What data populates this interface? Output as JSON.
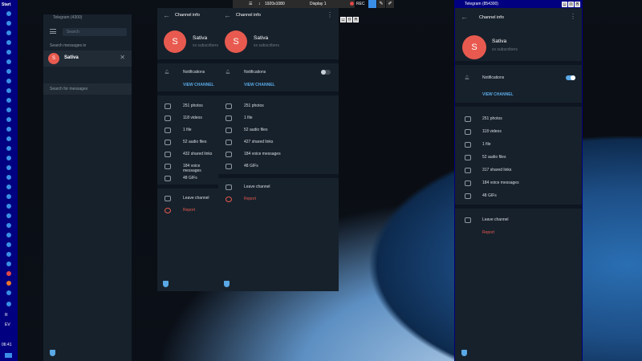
{
  "taskbar": {
    "start_label": "Start",
    "clock": "06:41",
    "misc1": "EV",
    "misc2": "R"
  },
  "display_toolbar": {
    "resolution": "1920x1080",
    "display": "Display 1",
    "rec": "REC"
  },
  "chat_list": {
    "title": "Telegram (4300)",
    "search_placeholder": "Search",
    "search_messages_in": "Search messages in",
    "chat_avatar": "S",
    "chat_name": "Sativa",
    "search_for_messages": "Search for messages"
  },
  "panel_left": {
    "header": "Channel info",
    "avatar": "S",
    "name": "Sativa",
    "subs": "xx subscribers",
    "notifications": "Notifications",
    "view_channel": "VIEW CHANNEL",
    "media": [
      "251 photos",
      "118 videos",
      "1 file",
      "52 audio files",
      "432 shared links",
      "184 voice messages",
      "48 GIFs"
    ],
    "leave": "Leave channel",
    "report": "Report"
  },
  "panel_mid": {
    "header": "Channel info",
    "avatar": "S",
    "name": "Sativa",
    "subs": "xx subscribers",
    "notifications": "Notifications",
    "view_channel": "VIEW CHANNEL",
    "media": [
      "251 photos",
      "1 file",
      "52 audio files",
      "427 shared links",
      "184 voice messages",
      "48 GIFs"
    ],
    "leave": "Leave channel",
    "report": "Report"
  },
  "panel_right": {
    "title": "Telegram (854300)",
    "header": "Channel info",
    "avatar": "S",
    "name": "Sativa",
    "subs": "xx subscribers",
    "notifications": "Notifications",
    "view_channel": "VIEW CHANNEL",
    "media": [
      "251 photos",
      "118 videos",
      "1 file",
      "52 audio files",
      "317 shared links",
      "184 voice messages",
      "48 GIFs"
    ],
    "leave": "Leave channel",
    "report": "Report"
  },
  "colors": {
    "accent": "#5aa9e6",
    "danger": "#e85a4f",
    "panel_bg": "#17212b",
    "taskbar": "#000080"
  }
}
